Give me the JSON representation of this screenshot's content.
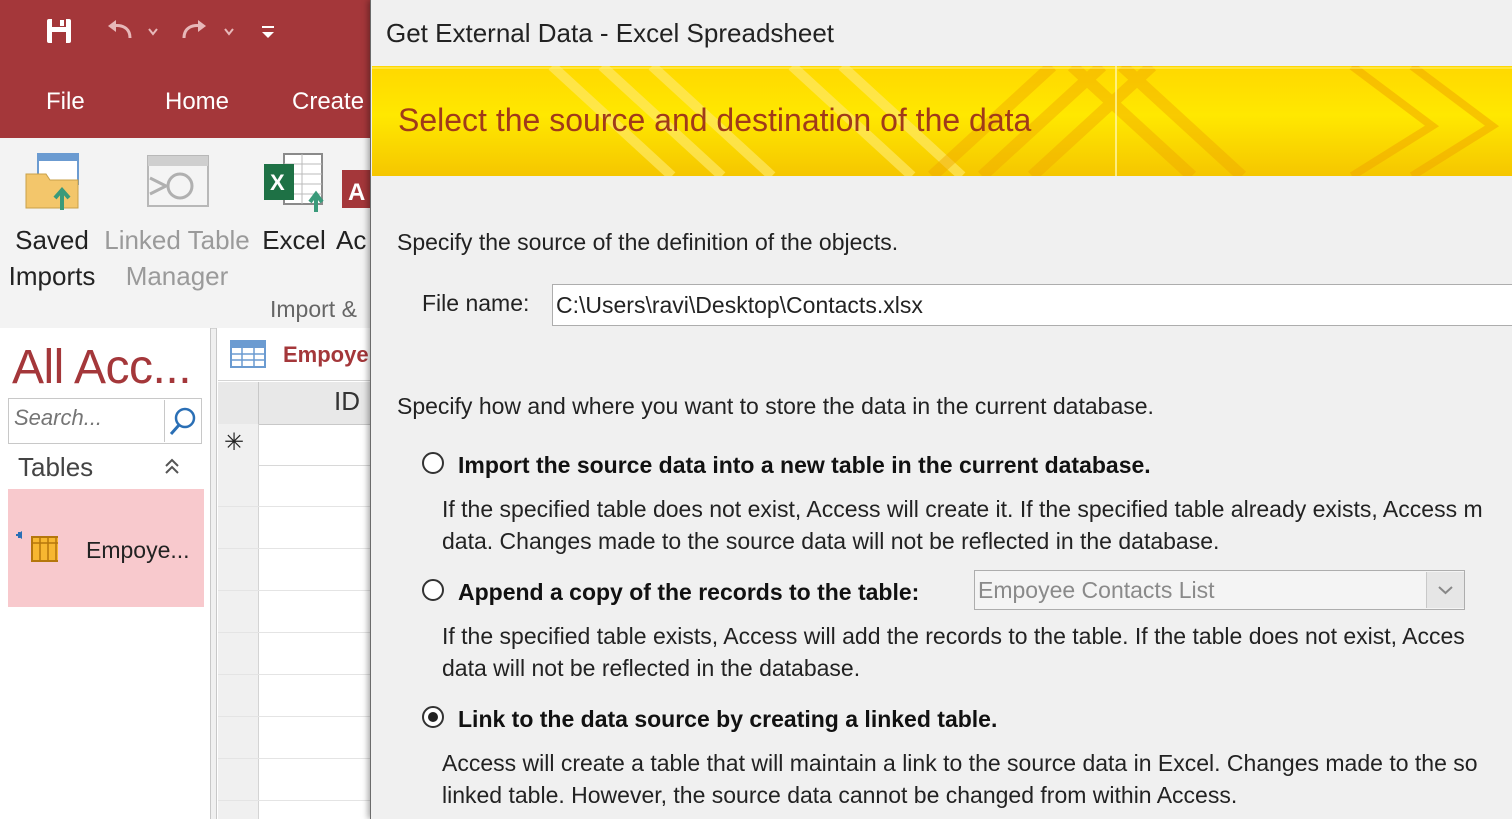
{
  "access": {
    "tabs": [
      "File",
      "Home",
      "Create"
    ],
    "ribbon": {
      "saved_imports": {
        "line1": "Saved",
        "line2": "Imports"
      },
      "linked_table_manager": {
        "line1": "Linked Table",
        "line2": "Manager"
      },
      "excel": "Excel",
      "access_partial": "Ac",
      "group_label": "Import &"
    },
    "nav": {
      "title": "All Acc...",
      "search_placeholder": "Search...",
      "section": "Tables",
      "item": "Empoye..."
    },
    "document": {
      "tab_label": "Empoye",
      "column_header": "ID",
      "new_row_glyph": "✳"
    }
  },
  "dialog": {
    "title": "Get External Data - Excel Spreadsheet",
    "banner": "Select the source and destination of the data",
    "source_heading": "Specify the source of the definition of the objects.",
    "file_label": "File name:",
    "file_value": "C:\\Users\\ravi\\Desktop\\Contacts.xlsx",
    "store_heading": "Specify how and where you want to store the data in the current database.",
    "options": [
      {
        "label": "Import the source data into a new table in the current database.",
        "selected": false,
        "desc1": "If the specified table does not exist, Access will create it. If the specified table already exists, Access m",
        "desc2": "data. Changes made to the source data will not be reflected in the database."
      },
      {
        "label": "Append a copy of the records to the table:",
        "selected": false,
        "select_value": "Empoyee Contacts List",
        "desc1": "If the specified table exists, Access will add the records to the table. If the table does not exist, Acces",
        "desc2": "data will not be reflected in the database."
      },
      {
        "label": "Link to the data source by creating a linked table.",
        "selected": true,
        "desc1": "Access will create a table that will maintain a link to the source data in Excel. Changes made to the so",
        "desc2": "linked table. However, the source data cannot be changed from within Access."
      }
    ]
  },
  "colors": {
    "access_red": "#a4373a",
    "banner_yellow": "#ffd800",
    "banner_text": "#a03a1a",
    "nav_selected": "#f8c9cd"
  }
}
